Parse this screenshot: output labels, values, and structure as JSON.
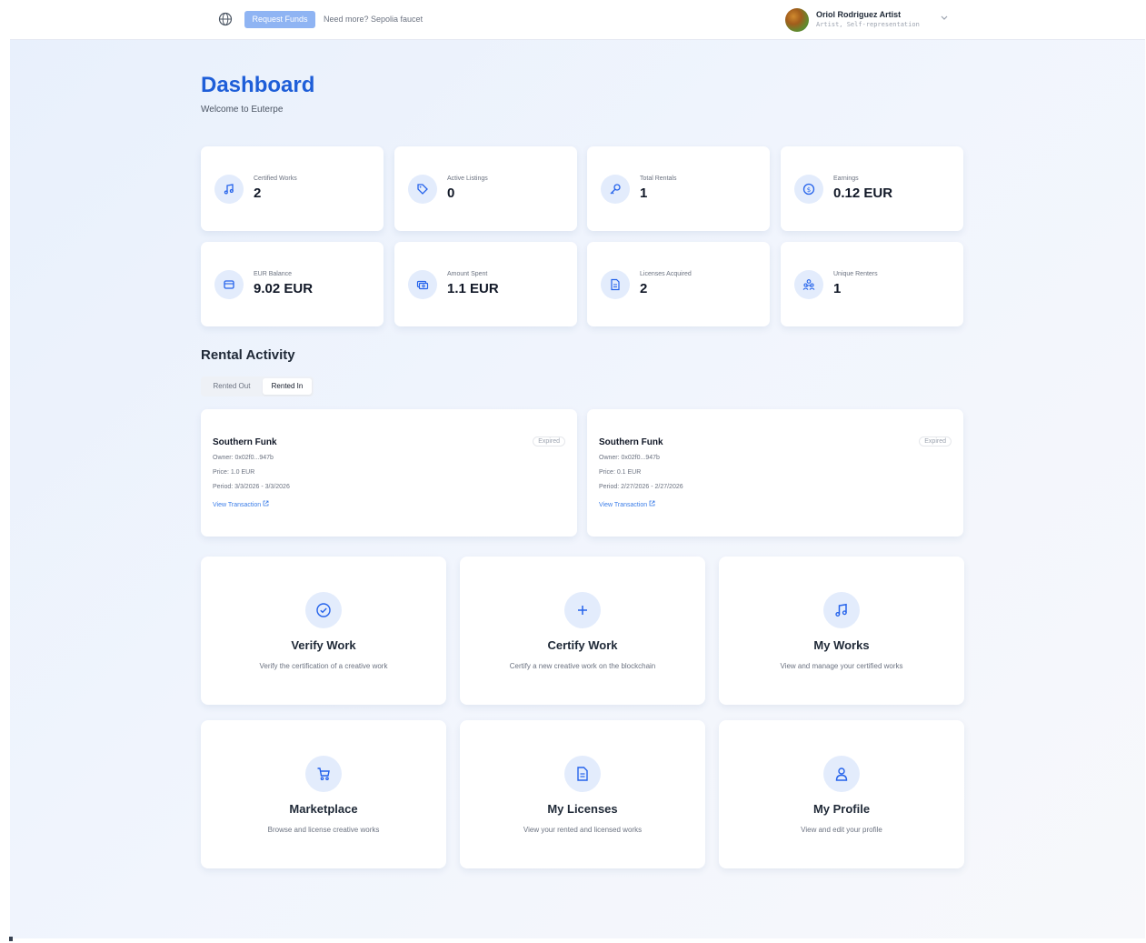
{
  "topbar": {
    "globe_icon": "globe-icon",
    "request_funds_label": "Request Funds",
    "need_more_text": "Need more? Sepolia faucet",
    "user_name": "Oriol Rodriguez Artist",
    "user_role": "Artist, Self-representation"
  },
  "header": {
    "title": "Dashboard",
    "subtitle": "Welcome to Euterpe"
  },
  "stats": [
    {
      "label": "Certified Works",
      "value": "2",
      "icon": "music-note-icon"
    },
    {
      "label": "Active Listings",
      "value": "0",
      "icon": "tag-icon"
    },
    {
      "label": "Total Rentals",
      "value": "1",
      "icon": "key-icon"
    },
    {
      "label": "Earnings",
      "value": "0.12 EUR",
      "icon": "dollar-circle-icon"
    },
    {
      "label": "EUR Balance",
      "value": "9.02 EUR",
      "icon": "wallet-icon"
    },
    {
      "label": "Amount Spent",
      "value": "1.1 EUR",
      "icon": "cash-icon"
    },
    {
      "label": "Licenses Acquired",
      "value": "2",
      "icon": "document-icon"
    },
    {
      "label": "Unique Renters",
      "value": "1",
      "icon": "users-icon"
    }
  ],
  "rental_activity": {
    "title": "Rental Activity",
    "tabs": [
      {
        "label": "Rented Out",
        "active": false
      },
      {
        "label": "Rented In",
        "active": true
      }
    ],
    "items": [
      {
        "title": "Southern Funk",
        "status": "Expired",
        "owner": "Owner: 0x02f0...947b",
        "price": "Price: 1.0 EUR",
        "period": "Period: 3/3/2026 - 3/3/2026",
        "link": "View Transaction"
      },
      {
        "title": "Southern Funk",
        "status": "Expired",
        "owner": "Owner: 0x02f0...947b",
        "price": "Price: 0.1 EUR",
        "period": "Period: 2/27/2026 - 2/27/2026",
        "link": "View Transaction"
      }
    ]
  },
  "actions": [
    {
      "title": "Verify Work",
      "desc": "Verify the certification of a creative work",
      "icon": "check-circle-icon"
    },
    {
      "title": "Certify Work",
      "desc": "Certify a new creative work on the blockchain",
      "icon": "plus-icon"
    },
    {
      "title": "My Works",
      "desc": "View and manage your certified works",
      "icon": "music-note-icon"
    },
    {
      "title": "Marketplace",
      "desc": "Browse and license creative works",
      "icon": "cart-icon"
    },
    {
      "title": "My Licenses",
      "desc": "View your rented and licensed works",
      "icon": "document-icon"
    },
    {
      "title": "My Profile",
      "desc": "View and edit your profile",
      "icon": "user-icon"
    }
  ],
  "colors": {
    "accent": "#1e5ed8",
    "icon_bg": "#e3ecfc",
    "button": "#8fb4f3",
    "link": "#3b7de8"
  }
}
